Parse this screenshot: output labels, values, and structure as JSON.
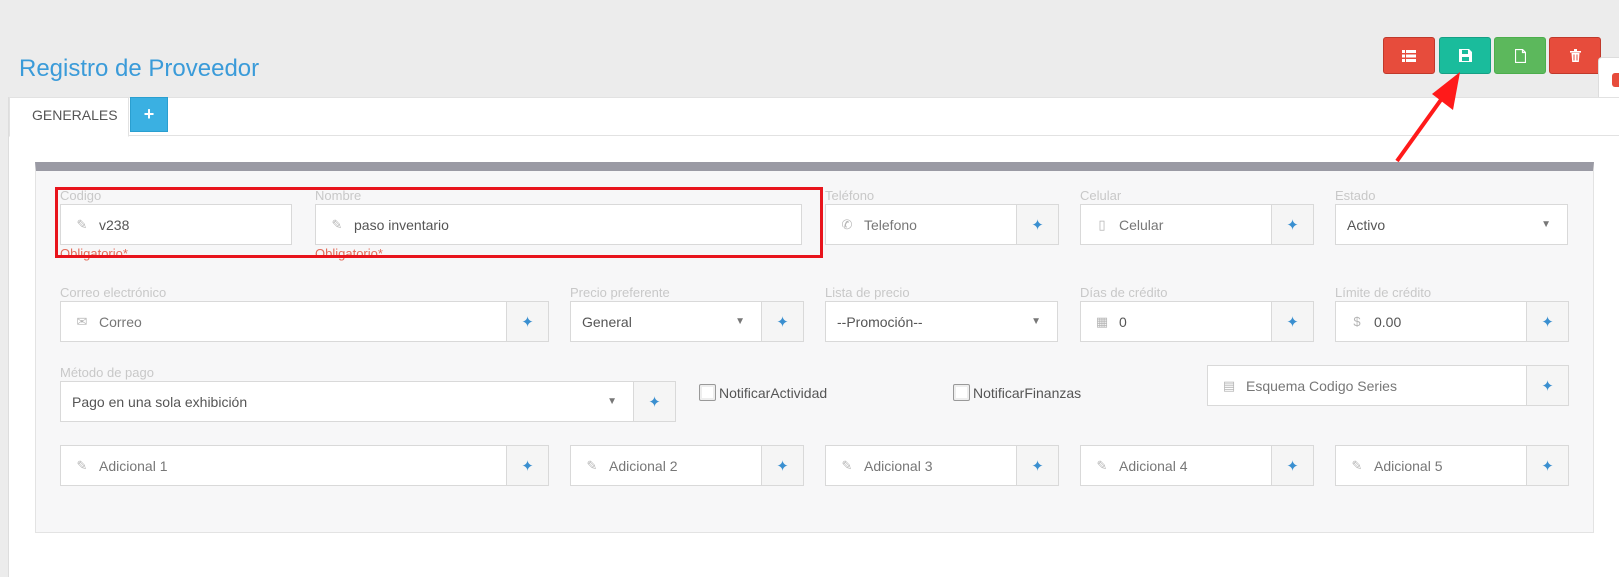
{
  "page": {
    "title": "Registro de Proveedor"
  },
  "toolbar": {
    "list_icon": "list-icon",
    "save_icon": "save-icon",
    "new_icon": "file-icon",
    "delete_icon": "trash-icon"
  },
  "tabs": {
    "generales": "GENERALES",
    "add_symbol": "+"
  },
  "form": {
    "codigo": {
      "label": "Codigo",
      "value": "v238",
      "required": "Obligatorio*"
    },
    "nombre": {
      "label": "Nombre",
      "value": "paso inventario",
      "required": "Obligatorio*"
    },
    "telefono": {
      "label": "Teléfono",
      "placeholder": "Telefono"
    },
    "celular": {
      "label": "Celular",
      "placeholder": "Celular"
    },
    "estado": {
      "label": "Estado",
      "value": "Activo"
    },
    "correo": {
      "label": "Correo electrónico",
      "placeholder": "Correo"
    },
    "precio_preferente": {
      "label": "Precio preferente",
      "value": "General"
    },
    "lista_precio": {
      "label": "Lista de precio",
      "value": "--Promoción--"
    },
    "dias_credito": {
      "label": "Días de crédito",
      "value": "0"
    },
    "limite_credito": {
      "label": "Límite de crédito",
      "value": "0.00",
      "currency": "$"
    },
    "metodo_pago": {
      "label": "Método de pago",
      "value": "Pago en una sola exhibición"
    },
    "notificar_actividad": {
      "label": "NotificarActividad",
      "checked": false
    },
    "notificar_finanzas": {
      "label": "NotificarFinanzas",
      "checked": false
    },
    "esquema": {
      "placeholder": "Esquema Codigo Series"
    },
    "adicional1": {
      "placeholder": "Adicional 1"
    },
    "adicional2": {
      "placeholder": "Adicional 2"
    },
    "adicional3": {
      "placeholder": "Adicional 3"
    },
    "adicional4": {
      "placeholder": "Adicional 4"
    },
    "adicional5": {
      "placeholder": "Adicional 5"
    }
  },
  "colors": {
    "title": "#3a9bd9",
    "danger": "#e74c3c",
    "save": "#1abc9c",
    "success": "#5cb85c",
    "info": "#3ab0e2",
    "annotation": "#e8141c"
  }
}
